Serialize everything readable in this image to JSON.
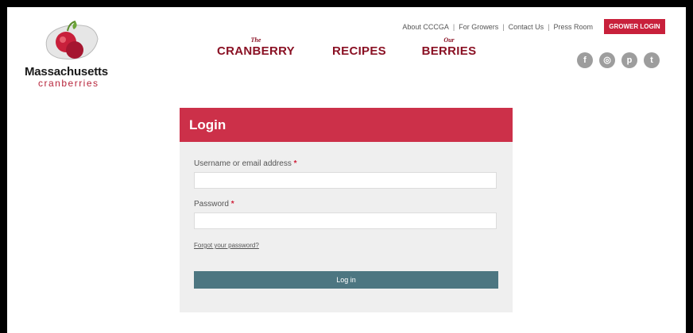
{
  "brand": {
    "name": "Massachusetts",
    "sub": "cranberries"
  },
  "top_links": [
    "About CCCGA",
    "For Growers",
    "Contact Us",
    "Press Room"
  ],
  "link_separator": "|",
  "grower_login": "GROWER LOGIN",
  "nav": [
    {
      "small": "The",
      "label": "CRANBERRY"
    },
    {
      "small": "",
      "label": "RECIPES"
    },
    {
      "small": "Our",
      "label": "BERRIES"
    }
  ],
  "social": [
    {
      "icon": "facebook-icon",
      "glyph": "f"
    },
    {
      "icon": "instagram-icon",
      "glyph": "◎"
    },
    {
      "icon": "pinterest-icon",
      "glyph": "p"
    },
    {
      "icon": "twitter-icon",
      "glyph": "t"
    }
  ],
  "login": {
    "title": "Login",
    "username_label": "Username or email address",
    "username_value": "",
    "password_label": "Password",
    "password_value": "",
    "required_mark": "*",
    "forgot": "Forgot your password?",
    "submit": "Log in"
  },
  "colors": {
    "brand_red": "#cc3049",
    "nav_maroon": "#8a1124",
    "button_teal": "#4d7681"
  }
}
